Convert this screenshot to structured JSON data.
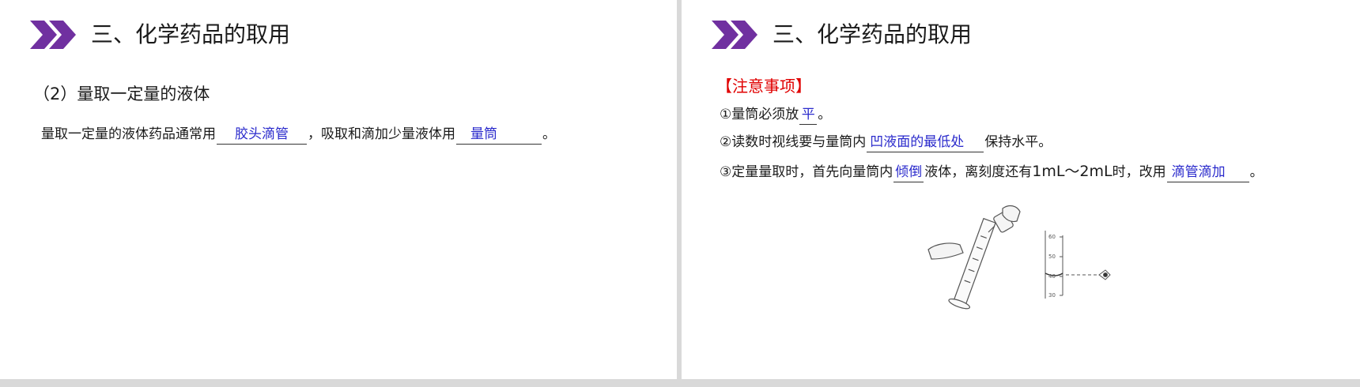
{
  "left_slide": {
    "title": "三、化学药品的取用",
    "subheading": "（2）量取一定量的液体",
    "sentence": {
      "part1": "量取一定量的液体药品通常用",
      "answer1": "胶头滴管",
      "part2": "，吸取和滴加少量液体用",
      "answer2": "量筒",
      "part3": "。"
    }
  },
  "right_slide": {
    "title": "三、化学药品的取用",
    "notice_heading": "【注意事项】",
    "item1": {
      "text": "①量筒必须放",
      "answer": "平",
      "end": "。"
    },
    "item2": {
      "text": "②读数时视线要与量筒内",
      "answer": "凹液面的最低处",
      "end": "保持水平。"
    },
    "item3": {
      "text": "③定量量取时，首先向量筒内",
      "answer1": "倾倒",
      "mid": "液体，离刻度还有",
      "range": "1mL～2mL",
      "mid2": "时，改用",
      "answer2": "滴管滴加",
      "end": "。"
    },
    "figure_scale": [
      "60",
      "50",
      "40",
      "30"
    ]
  },
  "colors": {
    "logo": "#7030a0",
    "answer": "#2b2bcc",
    "notice": "#e00000"
  }
}
